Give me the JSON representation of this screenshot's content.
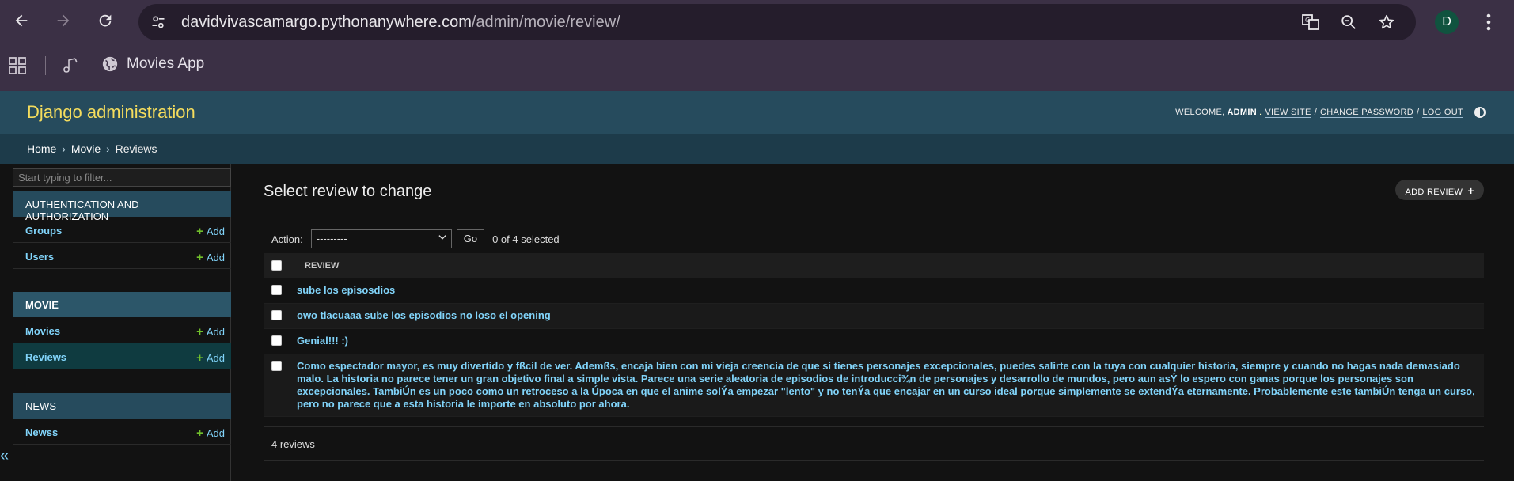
{
  "browser": {
    "url_host": "davidvivascamargo.pythonanywhere.com",
    "url_path": "/admin/movie/review/",
    "avatar_letter": "D",
    "bookmark_label": "Movies App"
  },
  "header": {
    "brand": "Django administration",
    "welcome": "WELCOME,",
    "user": "ADMIN",
    "view_site": "VIEW SITE",
    "change_password": "CHANGE PASSWORD",
    "log_out": "LOG OUT",
    "sep": "/"
  },
  "breadcrumbs": {
    "home": "Home",
    "movie": "Movie",
    "reviews": "Reviews",
    "sep": "›"
  },
  "sidebar": {
    "filter_placeholder": "Start typing to filter...",
    "auth_caption": "AUTHENTICATION AND AUTHORIZATION",
    "groups": "Groups",
    "users": "Users",
    "movie_caption": "MOVIE",
    "movies": "Movies",
    "reviews": "Reviews",
    "news_caption": "NEWS",
    "newss": "Newss",
    "add": "Add",
    "collapse": "«"
  },
  "content": {
    "title": "Select review to change",
    "add_review": "ADD REVIEW",
    "action_label": "Action:",
    "action_value": "---------",
    "go": "Go",
    "selected": "0 of 4 selected",
    "column": "REVIEW",
    "rows": [
      "sube los episosdios",
      "owo tlacuaaa sube los episodios no loso el opening",
      "Genial!!! :)",
      "Como espectador mayor, es muy divertido y fßcil de ver. Ademßs, encaja bien con mi vieja creencia de que si tienes personajes excepcionales, puedes salirte con la tuya con cualquier historia, siempre y cuando no hagas nada demasiado malo. La historia no parece tener un gran objetivo final a simple vista. Parece una serie aleatoria de episodios de introducci¾n de personajes y desarrollo de mundos, pero aun asÝ lo espero con ganas porque los personajes son excepcionales. TambiÚn es un poco como un retroceso a la Úpoca en que el anime solÝa empezar \"lento\" y no tenÝa que encajar en un curso ideal porque simplemente se extendÝa eternamente. Probablemente este tambiÚn tenga un curso, pero no parece que a esta historia le importe en absoluto por ahora."
    ],
    "count": "4 reviews"
  }
}
